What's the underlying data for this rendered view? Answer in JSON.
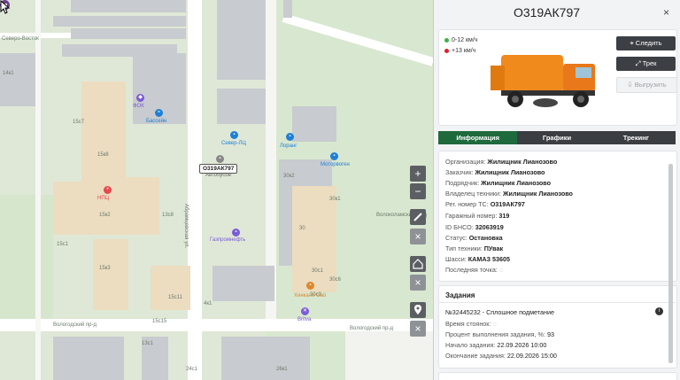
{
  "map": {
    "street_labels": [
      "Северо-Восток",
      "Волоколамский пр-д",
      "Вологодский пр-д",
      "Вологодский пр-д",
      "Абрамцевская ул."
    ],
    "building_labels": [
      "15с7",
      "15к8",
      "15к2",
      "15к3",
      "15с1",
      "13с8",
      "15с11",
      "15с15",
      "4к1",
      "30к2",
      "30к1",
      "30",
      "30с1",
      "30с6",
      "30с3",
      "26к1",
      "24с1",
      "14к1",
      "13с1"
    ],
    "pois": [
      {
        "name": "ФОК",
        "color": "#7b5cd6",
        "icon": "fok-icon"
      },
      {
        "name": "Бассейн",
        "color": "#1e7fd8",
        "icon": "pool-icon"
      },
      {
        "name": "НПЦ",
        "color": "#e5484d",
        "icon": "hospital-icon"
      },
      {
        "name": "Север-ЛЦ",
        "color": "#1e7fd8",
        "icon": "store-icon"
      },
      {
        "name": "Лоранг",
        "color": "#1e7fd8",
        "icon": "store-icon"
      },
      {
        "name": "Моторвоген",
        "color": "#1e7fd8",
        "icon": "car-icon"
      },
      {
        "name": "Газпромнефть",
        "color": "#7b5cd6",
        "icon": "fuel-icon"
      },
      {
        "name": "Хинкали Gali",
        "color": "#e0862a",
        "icon": "food-icon"
      },
      {
        "name": "Britva",
        "color": "#7b5cd6",
        "icon": "barber-icon"
      },
      {
        "name": "Автобусов",
        "color": "#888888",
        "icon": "bus-icon"
      }
    ],
    "vehicle_label": "О319АК797",
    "controls": [
      "zoom-in",
      "zoom-out",
      "ruler",
      "close",
      "home",
      "close",
      "pin",
      "close"
    ]
  },
  "panel": {
    "title": "О319АК797",
    "close_label": "×",
    "speeds": [
      {
        "label": "0-12 км/ч",
        "color": "#3cb043"
      },
      {
        "label": "+13 км/ч",
        "color": "#e0202a"
      }
    ],
    "buttons": {
      "follow": "Следить",
      "track": "Трек",
      "export": "Выгрузить"
    },
    "tabs": [
      "Информация",
      "Графики",
      "Трекинг"
    ],
    "info": [
      {
        "label": "Организация:",
        "value": "Жилищник Лианозово"
      },
      {
        "label": "Заказчик:",
        "value": "Жилищник Лианозово"
      },
      {
        "label": "Подрядчик:",
        "value": "Жилищник Лианозово"
      },
      {
        "label": "Владелец техники:",
        "value": "Жилищник Лианозово"
      },
      {
        "label": "Рег. номер ТС:",
        "value": "О319АК797"
      },
      {
        "label": "Гаражный номер:",
        "value": "319"
      },
      {
        "label": "ID БНСО:",
        "value": "32063919"
      },
      {
        "label": "Статус:",
        "value": "Остановка"
      },
      {
        "label": "Тип техники:",
        "value": "ПУвак"
      },
      {
        "label": "Шасси:",
        "value": "КАМАЗ 53605"
      },
      {
        "label": "Последняя точка:",
        "value": ""
      }
    ],
    "tasks": {
      "title": "Задания",
      "task_name": "№32445232 - Сплошное подметание",
      "rows": [
        {
          "label": "Время стоянок:",
          "value": ""
        },
        {
          "label": "Процент выполнения задания, %:",
          "value": "93"
        },
        {
          "label": "Начало задания:",
          "value": "22.09.2026 10:00"
        },
        {
          "label": "Окончание задания:",
          "value": "22.09.2026 15:00"
        }
      ]
    },
    "accent": "#1f6a3c"
  }
}
